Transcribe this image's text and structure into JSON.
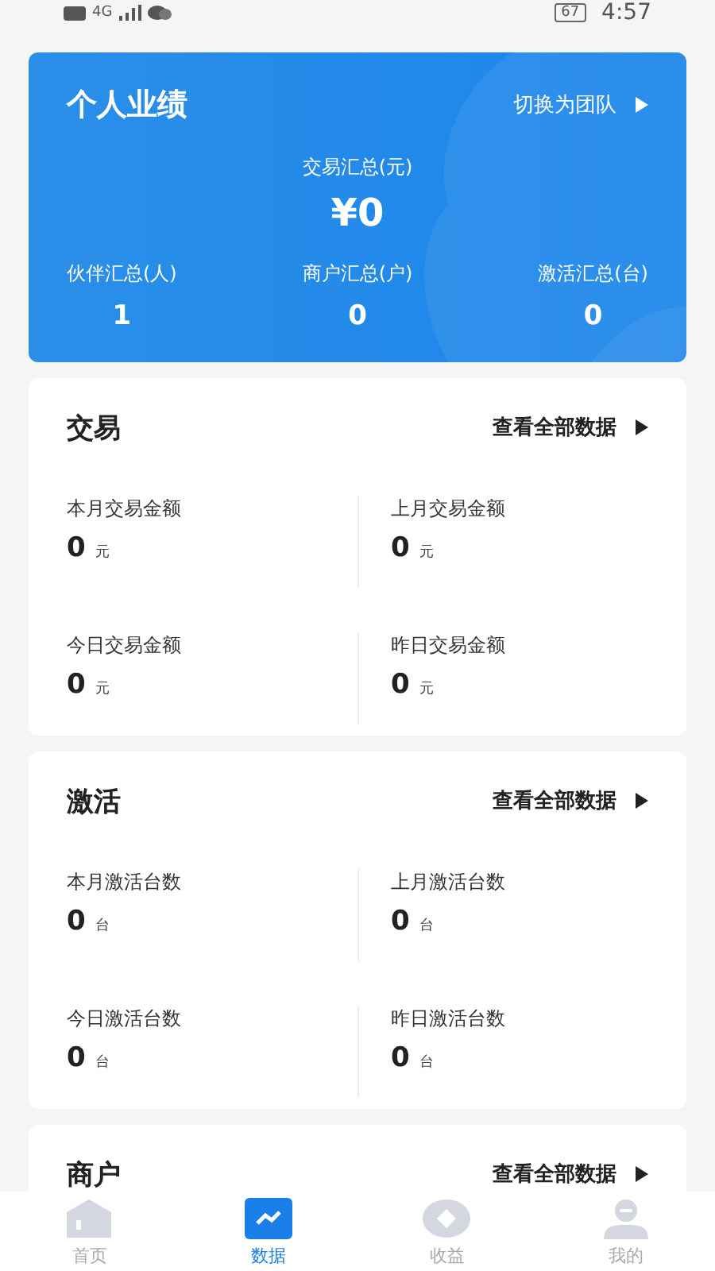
{
  "status_bar": {
    "time": "4:57",
    "battery": "67",
    "network": "4G"
  },
  "summary": {
    "title": "个人业绩",
    "switch_link": "切换为团队",
    "total_label": "交易汇总(元)",
    "total_value": "¥0",
    "stats": [
      {
        "label": "伙伴汇总(人)",
        "value": "1"
      },
      {
        "label": "商户汇总(户)",
        "value": "0"
      },
      {
        "label": "激活汇总(台)",
        "value": "0"
      }
    ]
  },
  "sections": [
    {
      "title": "交易",
      "link": "查看全部数据",
      "items": [
        {
          "label": "本月交易金额",
          "value": "0",
          "unit": "元"
        },
        {
          "label": "上月交易金额",
          "value": "0",
          "unit": "元"
        },
        {
          "label": "今日交易金额",
          "value": "0",
          "unit": "元"
        },
        {
          "label": "昨日交易金额",
          "value": "0",
          "unit": "元"
        }
      ]
    },
    {
      "title": "激活",
      "link": "查看全部数据",
      "items": [
        {
          "label": "本月激活台数",
          "value": "0",
          "unit": "台"
        },
        {
          "label": "上月激活台数",
          "value": "0",
          "unit": "台"
        },
        {
          "label": "今日激活台数",
          "value": "0",
          "unit": "台"
        },
        {
          "label": "昨日激活台数",
          "value": "0",
          "unit": "台"
        }
      ]
    },
    {
      "title": "商户",
      "link": "查看全部数据"
    }
  ],
  "tab_bar": [
    {
      "label": "首页",
      "kind": "home",
      "selected": false
    },
    {
      "label": "数据",
      "kind": "data",
      "selected": true
    },
    {
      "label": "收益",
      "kind": "earnings",
      "selected": false
    },
    {
      "label": "我的",
      "kind": "profile",
      "selected": false
    }
  ]
}
